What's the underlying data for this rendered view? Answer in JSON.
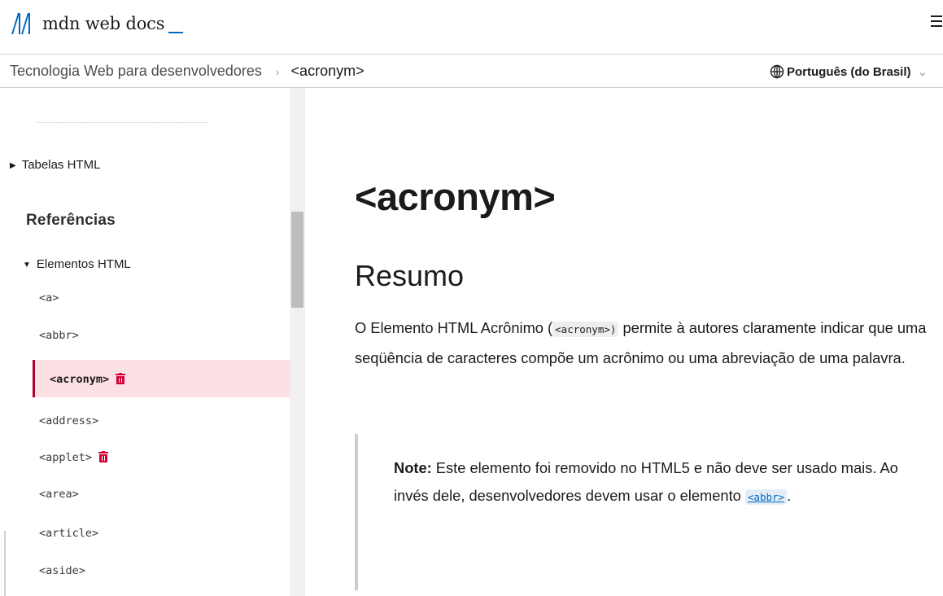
{
  "header": {
    "logo_text": "mdn web docs",
    "brand_color": "#0069c2",
    "menu_icon": "hamburger-icon"
  },
  "breadcrumb": {
    "root": "Tecnologia Web para desenvolvedores",
    "separator": "›",
    "current": "<acronym>"
  },
  "language": {
    "label": "Português (do Brasil)",
    "icon": "globe-icon",
    "caret": "⌄"
  },
  "sidebar": {
    "collapsed_item": "Tabelas HTML",
    "heading": "Referências",
    "expanded_group": "Elementos HTML",
    "items": [
      {
        "label": "<a>",
        "deprecated": false,
        "active": false
      },
      {
        "label": "<abbr>",
        "deprecated": false,
        "active": false
      },
      {
        "label": "<acronym>",
        "deprecated": true,
        "active": true
      },
      {
        "label": "<address>",
        "deprecated": false,
        "active": false
      },
      {
        "label": "<applet>",
        "deprecated": true,
        "active": false
      },
      {
        "label": "<area>",
        "deprecated": false,
        "active": false
      },
      {
        "label": "<article>",
        "deprecated": false,
        "active": false
      },
      {
        "label": "<aside>",
        "deprecated": false,
        "active": false
      }
    ],
    "active_color": "#fde0e3",
    "deprecated_icon": "trash-icon",
    "deprecated_color": "#d30038"
  },
  "article": {
    "title": "<acronym>",
    "section": "Resumo",
    "para_prefix": "O Elemento HTML Acrônimo (",
    "para_code": "<acronym>)",
    "para_suffix": " permite à autores claramente indicar que uma seqüência de caracteres compõe um acrônimo ou uma abreviação de uma palavra.",
    "note_label": "Note:",
    "note_text": " Este elemento foi removido no HTML5 e não deve ser usado mais. Ao invés dele, desenvolvedores devem usar o elemento ",
    "note_link": "<abbr>",
    "note_end": "."
  }
}
